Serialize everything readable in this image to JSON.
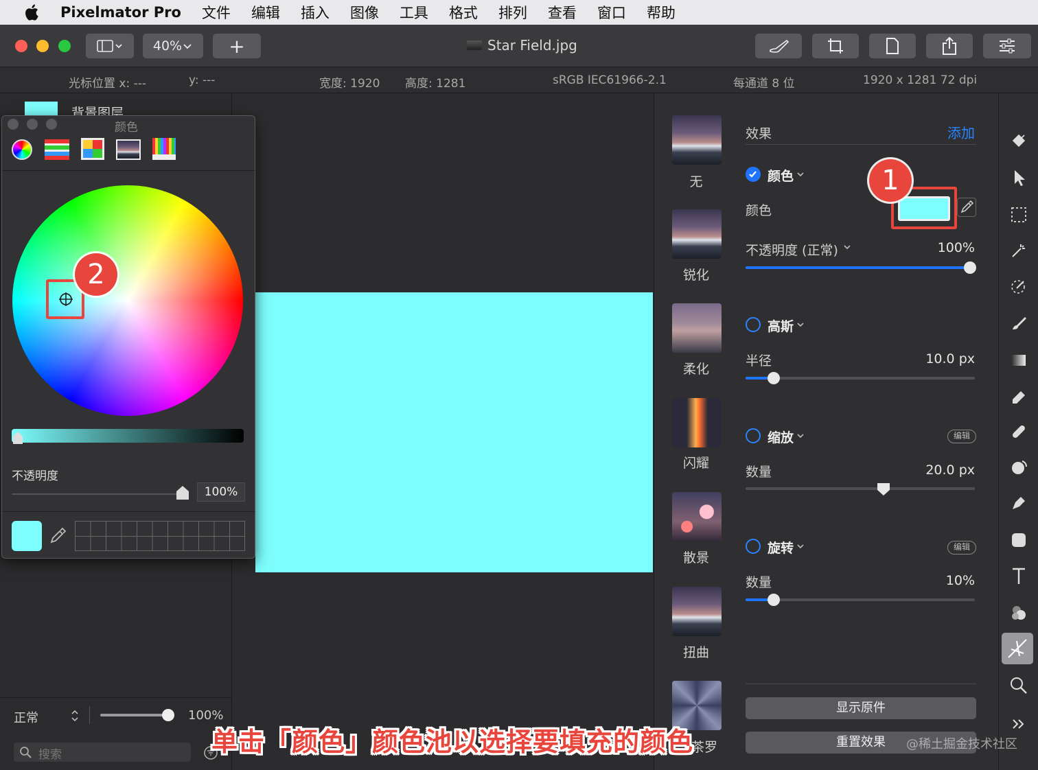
{
  "menubar": {
    "app_name": "Pixelmator Pro",
    "items": [
      "文件",
      "编辑",
      "插入",
      "图像",
      "工具",
      "格式",
      "排列",
      "查看",
      "窗口",
      "帮助"
    ]
  },
  "toolbar": {
    "zoom": "40%",
    "add": "+",
    "document_name": "Star Field.jpg"
  },
  "infobar": {
    "cursor_x": "光标位置 x:  ---",
    "cursor_y": "y:  ---",
    "width": "宽度:  1920",
    "height": "高度:  1281",
    "profile": "sRGB IEC61966-2.1",
    "bits": "每通道 8 位",
    "size": "1920 x 1281 72 dpi"
  },
  "layers": {
    "layer_name": "背景图层",
    "blend_mode": "正常",
    "opacity": "100%",
    "search_placeholder": "搜索"
  },
  "color_window": {
    "title": "颜色",
    "opacity_label": "不透明度",
    "opacity_value": "100%",
    "current_color": "#7dfdfd"
  },
  "presets": [
    {
      "label": "无"
    },
    {
      "label": "锐化"
    },
    {
      "label": "柔化"
    },
    {
      "label": "闪耀"
    },
    {
      "label": "散景"
    },
    {
      "label": "扭曲"
    },
    {
      "label": "茶罗"
    }
  ],
  "effects": {
    "header": "效果",
    "add": "添加",
    "color_group": {
      "title": "颜色",
      "color_label": "颜色",
      "opacity_label": "不透明度 (正常)",
      "opacity_value": "100%",
      "opacity_fraction": 1.0
    },
    "gauss_group": {
      "title": "高斯",
      "radius_label": "半径",
      "radius_value": "10.0 px"
    },
    "zoom_group": {
      "title": "缩放",
      "edit": "编辑",
      "amount_label": "数量",
      "amount_value": "20.0 px"
    },
    "rotate_group": {
      "title": "旋转",
      "edit": "编辑",
      "amount_label": "数量",
      "amount_value": "10%"
    },
    "show_original": "显示原件",
    "reset": "重置效果"
  },
  "annotations": {
    "badge1": "1",
    "badge2": "2",
    "caption": "单击「颜色」颜色池以选择要填充的颜色",
    "watermark": "@稀土掘金技术社区"
  },
  "colors": {
    "accent": "#1f74ff",
    "highlight": "#e8453c",
    "fill": "#7dfdfd"
  }
}
